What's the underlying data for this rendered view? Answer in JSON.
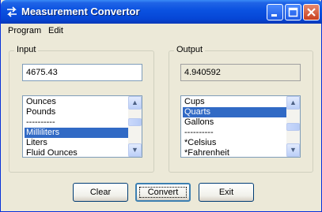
{
  "window": {
    "title": "Measurement Convertor",
    "title_bar_color": "#0a51e0"
  },
  "titlebar_buttons": {
    "minimize_icon": "minimize-icon",
    "maximize_icon": "maximize-icon",
    "close_icon": "close-icon"
  },
  "menu": {
    "items": [
      "Program",
      "Edit"
    ]
  },
  "input": {
    "legend": "Input",
    "value": "4675.43",
    "list": {
      "items": [
        "Ounces",
        "Pounds",
        "----------",
        "Milliliters",
        "Liters",
        "Fluid Ounces"
      ],
      "selected": "Milliliters"
    }
  },
  "output": {
    "legend": "Output",
    "value": "4.940592",
    "list": {
      "items": [
        "Cups",
        "Quarts",
        "Gallons",
        "----------",
        "*Celsius",
        "*Fahrenheit"
      ],
      "selected": "Quarts"
    }
  },
  "buttons": {
    "clear": "Clear",
    "convert": "Convert",
    "exit": "Exit"
  },
  "colors": {
    "selection": "#316ac5",
    "window_bg": "#ece9d8"
  }
}
